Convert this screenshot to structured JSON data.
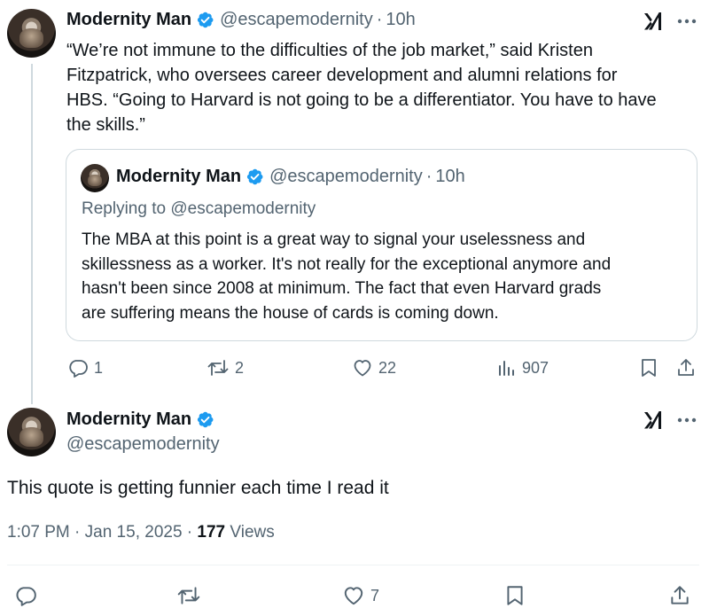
{
  "parent_tweet": {
    "author_name": "Modernity Man",
    "handle": "@escapemodernity",
    "separator": "·",
    "time": "10h",
    "text_lines": [
      "“We’re not immune to the difficulties of the job market,” said Kristen",
      "Fitzpatrick, who oversees career development and alumni relations for",
      "HBS. “Going to Harvard is not going to be a differentiator. You have to have",
      "the skills.”"
    ],
    "quoted": {
      "author_name": "Modernity Man",
      "handle": "@escapemodernity",
      "separator": "·",
      "time": "10h",
      "replying_to": "Replying to @escapemodernity",
      "text_lines": [
        "The MBA at this point is a great way to signal your uselessness and",
        "skillessness as a worker. It's not really for the exceptional anymore and",
        "hasn't been since 2008 at minimum. The fact that even Harvard grads",
        "are suffering means the house of cards is coming down."
      ]
    },
    "actions": {
      "replies": "1",
      "reposts": "2",
      "likes": "22",
      "views": "907"
    }
  },
  "main_tweet": {
    "author_name": "Modernity Man",
    "handle": "@escapemodernity",
    "text": "This quote is getting funnier each time I read it",
    "time": "1:07 PM · Jan 15, 2025 · ",
    "views_count": "177",
    "views_label": " Views",
    "actions": {
      "likes": "7"
    }
  },
  "colors": {
    "verified_blue": "#1d9bf0",
    "secondary_text": "#536471",
    "primary_text": "#0f1419",
    "border": "#cfd9de"
  },
  "icons": [
    "grok-icon",
    "more-icon",
    "verified-badge-icon",
    "reply-icon",
    "repost-icon",
    "like-icon",
    "views-icon",
    "bookmark-icon",
    "share-icon"
  ]
}
